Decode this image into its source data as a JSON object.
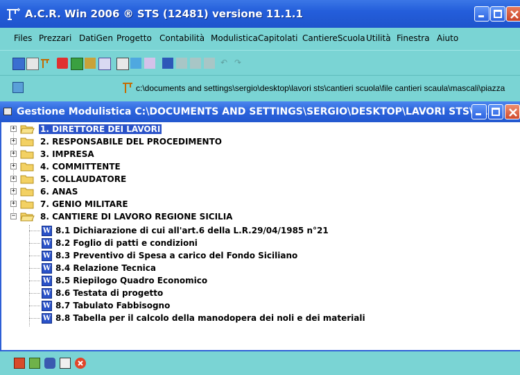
{
  "app": {
    "title": "A.C.R. Win 2006 ®     STS (12481) versione 11.1.1"
  },
  "menu": [
    "Files",
    "Prezzari",
    "DatiGen",
    "Progetto",
    "Contabilità",
    "Modulistica",
    "Capitolati",
    "CantiereScuola",
    "Utilità",
    "Finestra",
    "Aiuto"
  ],
  "path_bar": {
    "path": "c:\\documents and settings\\sergio\\desktop\\lavori sts\\cantieri scuola\\file cantieri scaula\\mascali\\piazza"
  },
  "child_window": {
    "title": "Gestione Modulistica   C:\\DOCUMENTS AND SETTINGS\\SERGIO\\DESKTOP\\LAVORI STS\\CA..."
  },
  "tree": {
    "nodes": [
      {
        "label": "1.  DIRETTORE DEI LAVORI",
        "selected": true
      },
      {
        "label": "2.  RESPONSABILE DEL PROCEDIMENTO"
      },
      {
        "label": "3.  IMPRESA"
      },
      {
        "label": "4.  COMMITTENTE"
      },
      {
        "label": "5.  COLLAUDATORE"
      },
      {
        "label": "6.  ANAS"
      },
      {
        "label": "7.  GENIO MILITARE"
      },
      {
        "label": "8.  CANTIERE DI LAVORO REGIONE SICILIA",
        "expanded": true
      }
    ],
    "children": [
      "8.1  Dichiarazione di cui all'art.6 della L.R.29/04/1985 n°21",
      "8.2  Foglio di patti e condizioni",
      "8.3  Preventivo di Spesa a carico del Fondo Siciliano",
      "8.4  Relazione Tecnica",
      "8.5  Riepilogo Quadro Economico",
      "8.6  Testata di progetto",
      "8.7  Tabulato Fabbisogno",
      "8.8  Tabella per il calcolo della manodopera dei noli e dei materiali"
    ]
  },
  "glyphs": {
    "expand": "+",
    "collapse": "−",
    "word": "W"
  }
}
